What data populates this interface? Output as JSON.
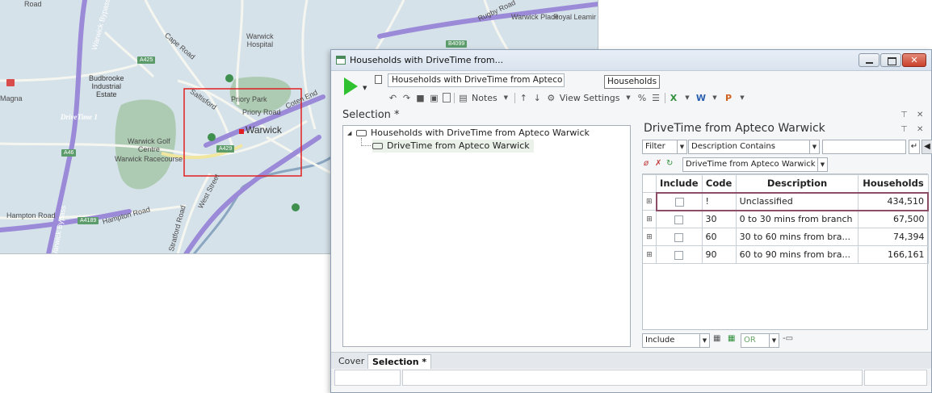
{
  "map": {
    "labels": {
      "road_top_left": "Road",
      "warwick_bypass": "Warwick Bypass",
      "cape_road": "Cape Road",
      "warwick_hospital": "Warwick\nHospital",
      "budbrooke": "Budbrooke\nIndustrial\nEstate",
      "magna": "Magna",
      "drivetime_label": "DriveTime 1",
      "warwick_golf": "Warwick Golf\nCentre",
      "warwick_racecourse": "Warwick Racecourse",
      "saltisford": "Saltisford",
      "priory_park": "Priory Park",
      "priory_road": "Priory Road",
      "coten_end": "Coten End",
      "warwick": "Warwick",
      "west_street": "West Street",
      "stratford_road": "Stratford Road",
      "hampton_road_left": "Hampton Road",
      "hampton_road_mid": "Hampton Road",
      "warwick_bypass_bottom": "Warwick Bypass",
      "rugby_road": "Rugby Road",
      "warwick_place": "Warwick Place",
      "royal_leamington": "Royal Leamir",
      "a425": "A425",
      "a429": "A429",
      "a46": "A46",
      "a4189": "A4189",
      "b4099": "B4099"
    },
    "colors": {
      "background": "#d6e2ea",
      "green_area": "#a9c9ac",
      "drivetime_road": "#9a8ad8",
      "selection_box": "#e02020",
      "dot": "#3f8f4f"
    }
  },
  "window": {
    "title": "Households with DriveTime from...",
    "toolbar": {
      "selection_name": "Households with DriveTime from Apteco Warwick",
      "table_name": "Households",
      "notes_label": "Notes",
      "view_settings_label": "View Settings"
    },
    "selection_label": "Selection *",
    "tree": {
      "root_label": "Households with DriveTime from Apteco Warwick",
      "child_label": "DriveTime from Apteco Warwick"
    },
    "right_pane": {
      "title": "DriveTime from Apteco Warwick",
      "filter_label": "Filter",
      "filter_mode": "Description Contains",
      "filter_value": "",
      "variable_name": "DriveTime from Apteco Warwick",
      "columns": [
        "Include",
        "Code",
        "Description",
        "Households"
      ],
      "rows": [
        {
          "code": "!",
          "description": "Unclassified",
          "households": "434,510"
        },
        {
          "code": "30",
          "description": "0 to 30 mins from branch",
          "households": "67,500"
        },
        {
          "code": "60",
          "description": "30 to 60 mins from bra...",
          "households": "74,394"
        },
        {
          "code": "90",
          "description": "60 to 90 mins from bra...",
          "households": "166,161"
        }
      ],
      "include_mode": "Include",
      "logic_mode": "OR"
    },
    "tabs": [
      "Cover",
      "Selection *"
    ],
    "colors": {
      "run_button": "#2fc12f",
      "selected_row_border": "#8c4d66",
      "tree_child_highlight": "#eaf2ea"
    }
  }
}
